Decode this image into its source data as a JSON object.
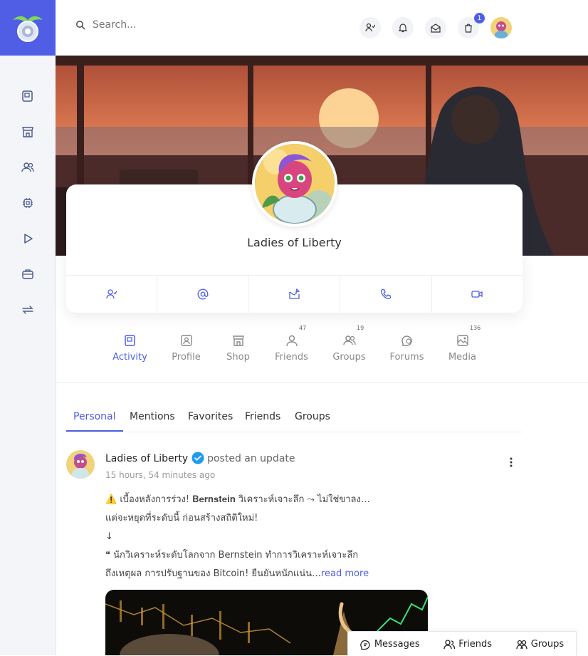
{
  "colors": {
    "accent": "#4f5ee5",
    "sidebar_bg": "#f3f5f9"
  },
  "topbar": {
    "search_placeholder": "Search...",
    "cart_count": "1",
    "icons": [
      "search-icon",
      "add-friend-icon",
      "bell-icon",
      "mail-icon",
      "cart-icon",
      "avatar"
    ]
  },
  "sidebar": {
    "icons": [
      "activity-icon",
      "shop-icon",
      "people-icon",
      "robot-icon",
      "play-icon",
      "briefcase-icon",
      "swap-icon"
    ]
  },
  "profile": {
    "name": "Ladies of Liberty",
    "actions": [
      "add-friend-icon",
      "mention-icon",
      "message-icon",
      "phone-icon",
      "video-icon"
    ]
  },
  "profile_tabs": [
    {
      "label": "Activity",
      "count": "",
      "icon": "activity-icon"
    },
    {
      "label": "Profile",
      "count": "",
      "icon": "profile-icon"
    },
    {
      "label": "Shop",
      "count": "",
      "icon": "shop-icon"
    },
    {
      "label": "Friends",
      "count": "47",
      "icon": "friend-icon"
    },
    {
      "label": "Groups",
      "count": "19",
      "icon": "group-icon"
    },
    {
      "label": "Forums",
      "count": "",
      "icon": "forum-icon"
    },
    {
      "label": "Media",
      "count": "136",
      "icon": "media-icon"
    }
  ],
  "sub_tabs": [
    "Personal",
    "Mentions",
    "Favorites",
    "Friends",
    "Groups"
  ],
  "post": {
    "author": "Ladies of Liberty",
    "action": "posted an update",
    "time": "15 hours, 54 minutes ago",
    "lines": [
      "⚠️ เบื้องหลังการร่วง! 𝐁𝐞𝐫𝐧𝐬𝐭𝐞𝐢𝐧 วิเคราะห์เจาะลึก ⤳ ไม่ใช่ขาลง…",
      "แต่จะหยุดที่ระดับนี้ ก่อนสร้างสถิติใหม่!",
      "↓",
      "❝ นักวิเคราะห์ระดับโลกจาก Bernstein ทำการวิเคราะห์เจาะลึก",
      "ถึงเหตุผล การปรับฐานของ Bitcoin! ยืนยันหนักแน่น…"
    ],
    "read_more": "read more"
  },
  "chat_bar": {
    "messages": "Messages",
    "friends": "Friends",
    "groups": "Groups"
  }
}
